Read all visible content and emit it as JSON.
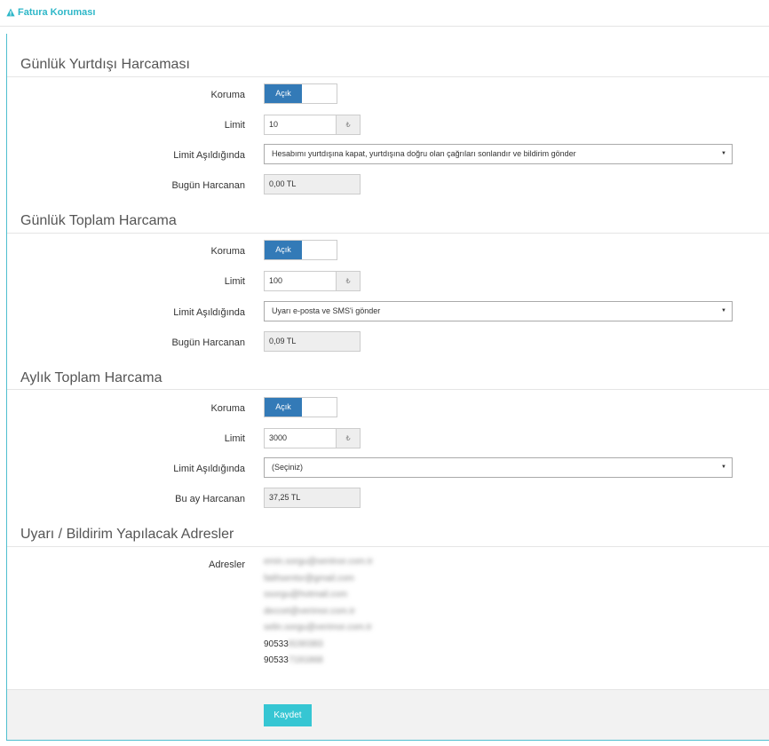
{
  "header": {
    "title": "Fatura Koruması"
  },
  "sections": [
    {
      "title": "Günlük Yurtdışı Harcaması",
      "koruma_label": "Koruma",
      "toggle_label": "Açık",
      "limit_label": "Limit",
      "limit_value": "10",
      "currency": "₺",
      "exceed_label": "Limit Aşıldığında",
      "exceed_value": "Hesabımı yurtdışına kapat, yurtdışına doğru olan çağrıları sonlandır ve bildirim gönder",
      "spent_label": "Bugün Harcanan",
      "spent_value": "0,00 TL"
    },
    {
      "title": "Günlük Toplam Harcama",
      "koruma_label": "Koruma",
      "toggle_label": "Açık",
      "limit_label": "Limit",
      "limit_value": "100",
      "currency": "₺",
      "exceed_label": "Limit Aşıldığında",
      "exceed_value": "Uyarı e-posta ve SMS'i gönder",
      "spent_label": "Bugün Harcanan",
      "spent_value": "0,09 TL"
    },
    {
      "title": "Aylık Toplam Harcama",
      "koruma_label": "Koruma",
      "toggle_label": "Açık",
      "limit_label": "Limit",
      "limit_value": "3000",
      "currency": "₺",
      "exceed_label": "Limit Aşıldığında",
      "exceed_value": "(Seçiniz)",
      "spent_label": "Bu ay Harcanan",
      "spent_value": "37,25 TL"
    }
  ],
  "addresses": {
    "title": "Uyarı / Bildirim Yapılacak Adresler",
    "label": "Adresler",
    "items": [
      {
        "visible": "",
        "obscured": "emin.sorgu@sentnor.com.tr"
      },
      {
        "visible": "",
        "obscured": "fatihsentsr@gmail.com"
      },
      {
        "visible": "",
        "obscured": "ssorgu@hotmail.com"
      },
      {
        "visible": "",
        "obscured": "deccet@verimor.com.tr"
      },
      {
        "visible": "",
        "obscured": "selin.sorgu@verimor.com.tr"
      },
      {
        "visible": "90533",
        "obscured": "8190383"
      },
      {
        "visible": "90533",
        "obscured": "7191868"
      }
    ]
  },
  "footer": {
    "save_label": "Kaydet"
  },
  "colors": {
    "accent": "#36c6d3",
    "toggle_on": "#337ab7",
    "title": "#2eb7c8"
  }
}
